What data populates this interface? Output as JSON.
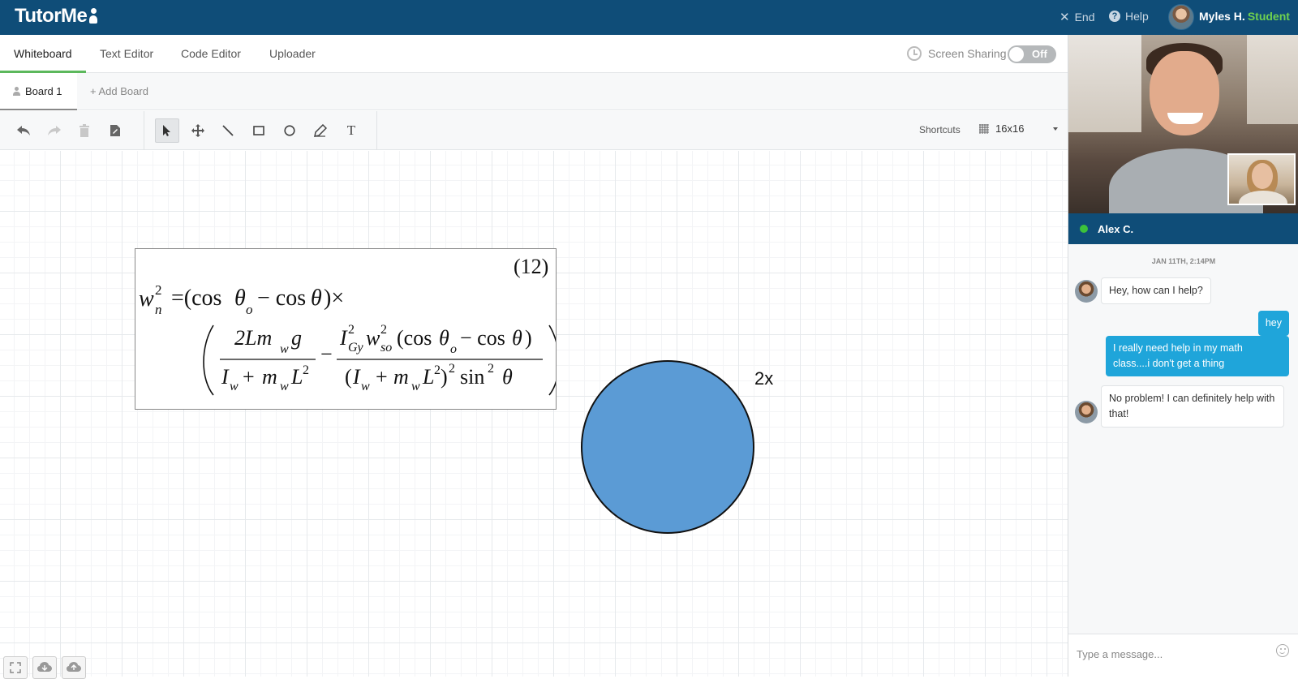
{
  "header": {
    "logo": "TutorMe",
    "end_label": "End",
    "help_label": "Help",
    "user_name": "Myles H.",
    "user_role": "Student"
  },
  "tabs": [
    {
      "label": "Whiteboard",
      "active": true
    },
    {
      "label": "Text Editor",
      "active": false
    },
    {
      "label": "Code Editor",
      "active": false
    },
    {
      "label": "Uploader",
      "active": false
    }
  ],
  "screen_sharing": {
    "label": "Screen Sharing",
    "state": "Off"
  },
  "boards": {
    "current": "Board 1",
    "add_label": "+ Add Board"
  },
  "toolbar": {
    "shortcuts_label": "Shortcuts",
    "grid_label": "16x16",
    "tools": [
      "undo-icon",
      "redo-icon",
      "trash-icon",
      "export-icon",
      "select-icon",
      "move-icon",
      "line-icon",
      "rectangle-icon",
      "ellipse-icon",
      "pencil-icon",
      "text-icon"
    ],
    "selected_tool": "select-icon"
  },
  "canvas": {
    "equation_number": "(12)",
    "shape_label": "2x",
    "shape_color": "#5b9bd5"
  },
  "colors": {
    "brand": "#0f4d78",
    "accent_green": "#5cb85c",
    "chat_out": "#1fa5da"
  },
  "video": {
    "tutor_name": "Alex C.",
    "status": "online"
  },
  "chat": {
    "date": "JAN 11TH, 2:14PM",
    "messages": [
      {
        "from": "tutor",
        "text": "Hey, how can I help?"
      },
      {
        "from": "student",
        "text": "hey"
      },
      {
        "from": "student",
        "text": "I really need help in my math class....i don't get a thing"
      },
      {
        "from": "tutor",
        "text": "No problem! I can definitely help with that!"
      }
    ],
    "input_placeholder": "Type a message..."
  }
}
